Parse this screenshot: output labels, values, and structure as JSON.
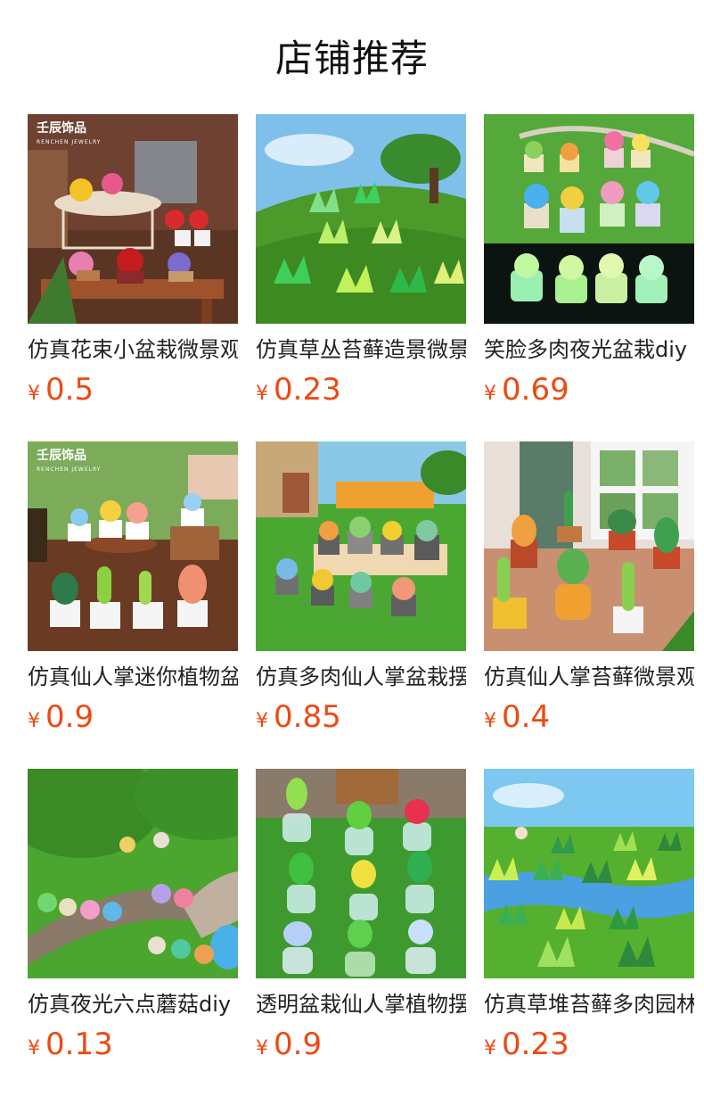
{
  "title": "店铺推荐",
  "currency": "¥",
  "products": [
    {
      "name": "仿真花束小盆栽微景观",
      "price": "0.5",
      "brand": "壬辰饰品",
      "brand_sub": "RENCHEN JEWELRY"
    },
    {
      "name": "仿真草丛苔藓造景微景观",
      "price": "0.23"
    },
    {
      "name": "笑脸多肉夜光盆栽diy",
      "price": "0.69"
    },
    {
      "name": "仿真仙人掌迷你植物盆栽",
      "price": "0.9",
      "brand": "壬辰饰品",
      "brand_sub": "RENCHEN JEWELRY"
    },
    {
      "name": "仿真多肉仙人掌盆栽摆件",
      "price": "0.85"
    },
    {
      "name": "仿真仙人掌苔藓微景观",
      "price": "0.4"
    },
    {
      "name": "仿真夜光六点蘑菇diy",
      "price": "0.13"
    },
    {
      "name": "透明盆栽仙人掌植物摆件",
      "price": "0.9"
    },
    {
      "name": "仿真草堆苔藓多肉园林",
      "price": "0.23"
    }
  ]
}
